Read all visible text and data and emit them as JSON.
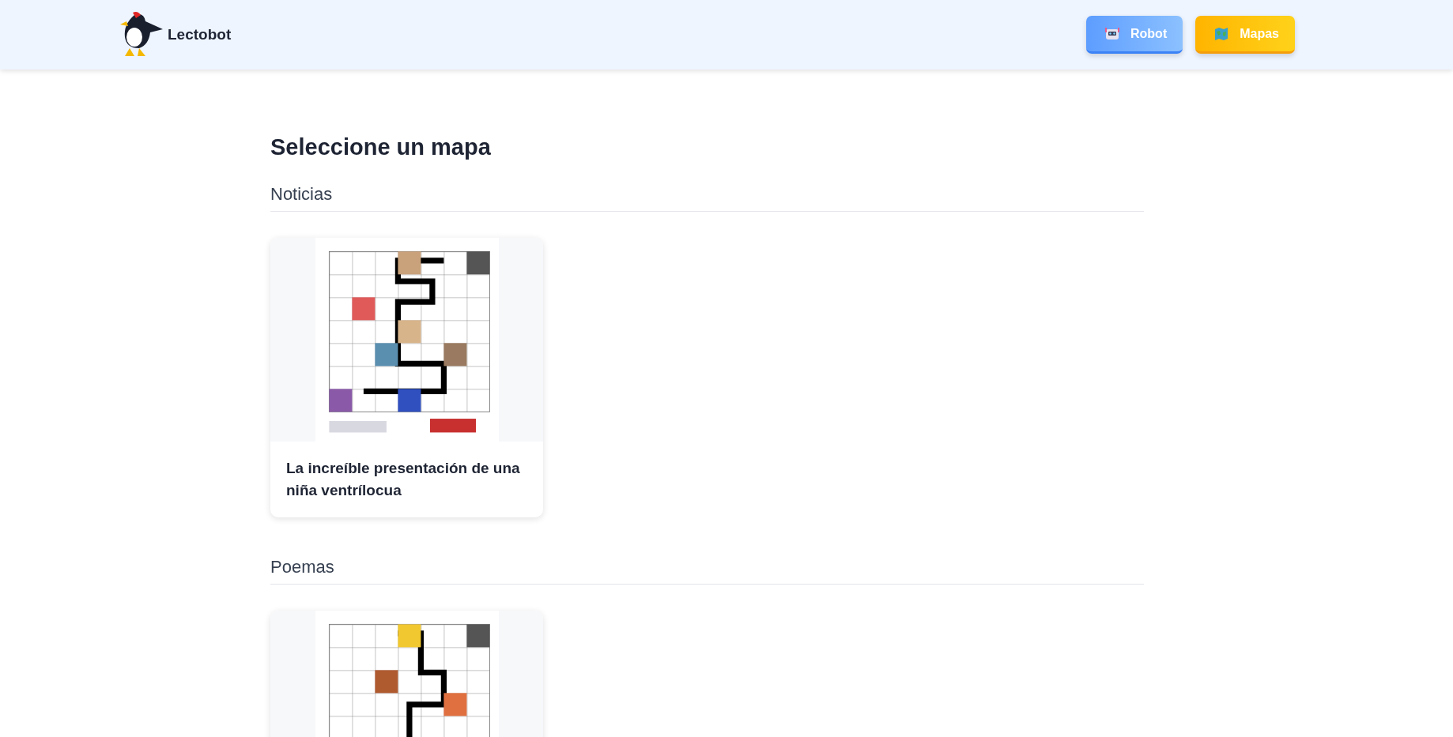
{
  "header": {
    "logo_text": "Lectobot",
    "buttons": [
      {
        "label": "Robot",
        "kind": "robot"
      },
      {
        "label": "Mapas",
        "kind": "map"
      }
    ]
  },
  "page_title": "Seleccione un mapa",
  "sections": [
    {
      "title": "Noticias",
      "maps": [
        {
          "kind": "picture",
          "title": "La increíble presentación de una niña ventrílocua"
        }
      ]
    },
    {
      "title": "Poemas"
    }
  ]
}
